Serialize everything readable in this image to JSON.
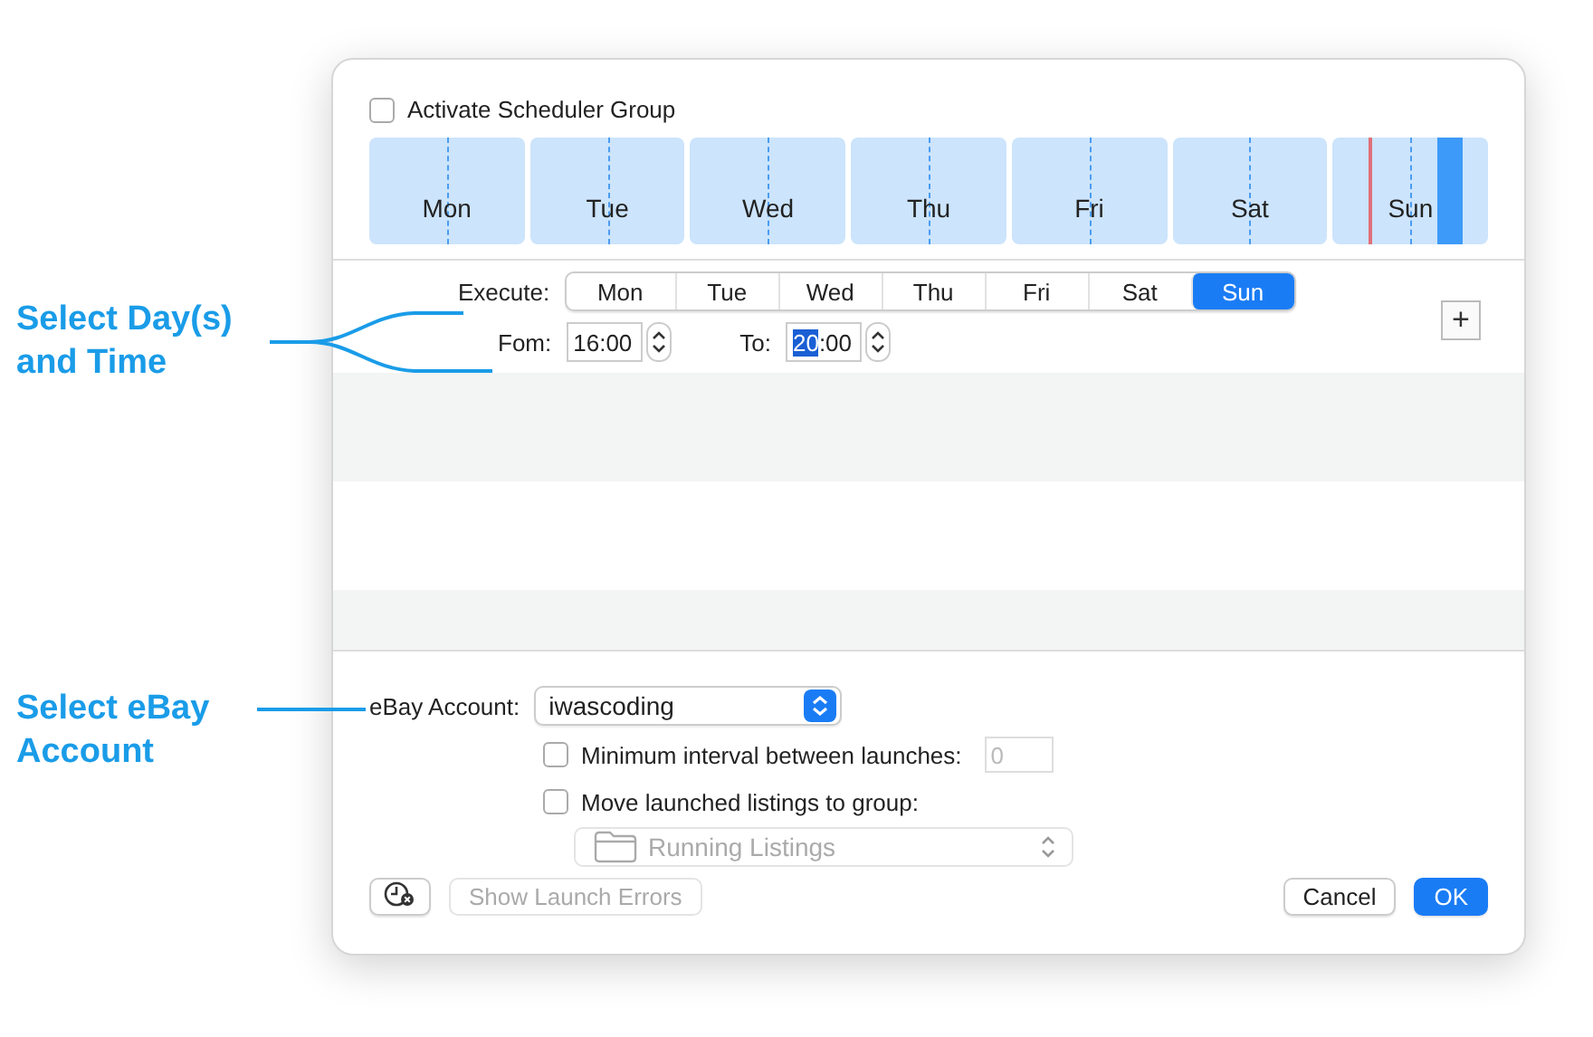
{
  "callouts": [
    {
      "text": "Select Day(s) and Time"
    },
    {
      "text": "Select eBay Account"
    }
  ],
  "activate": {
    "label": "Activate Scheduler Group",
    "checked": false
  },
  "timeline": [
    {
      "day": "Mon",
      "current": false,
      "scheduled": false
    },
    {
      "day": "Tue",
      "current": false,
      "scheduled": false
    },
    {
      "day": "Wed",
      "current": false,
      "scheduled": false
    },
    {
      "day": "Thu",
      "current": false,
      "scheduled": false
    },
    {
      "day": "Fri",
      "current": false,
      "scheduled": false
    },
    {
      "day": "Sat",
      "current": false,
      "scheduled": false
    },
    {
      "day": "Sun",
      "current": true,
      "scheduled": true
    }
  ],
  "execute": {
    "label": "Execute:",
    "days": [
      {
        "label": "Mon",
        "selected": false
      },
      {
        "label": "Tue",
        "selected": false
      },
      {
        "label": "Wed",
        "selected": false
      },
      {
        "label": "Thu",
        "selected": false
      },
      {
        "label": "Fri",
        "selected": false
      },
      {
        "label": "Sat",
        "selected": false
      },
      {
        "label": "Sun",
        "selected": true
      }
    ]
  },
  "from": {
    "label": "Fom:",
    "value": "16:00"
  },
  "to": {
    "label": "To:",
    "hour": "20",
    "rest": ":00"
  },
  "add_button": "+",
  "account": {
    "label": "eBay Account:",
    "value": "iwascoding"
  },
  "min_interval": {
    "label": "Minimum interval between launches:",
    "checked": false,
    "placeholder": "0"
  },
  "move_listings": {
    "label": "Move launched listings to group:",
    "checked": false
  },
  "group_popup": {
    "value": "Running Listings",
    "disabled": true
  },
  "show_errors": {
    "label": "Show Launch Errors",
    "disabled": true
  },
  "buttons": [
    {
      "label": "Cancel",
      "kind": "cancel"
    },
    {
      "label": "OK",
      "kind": "default"
    }
  ]
}
